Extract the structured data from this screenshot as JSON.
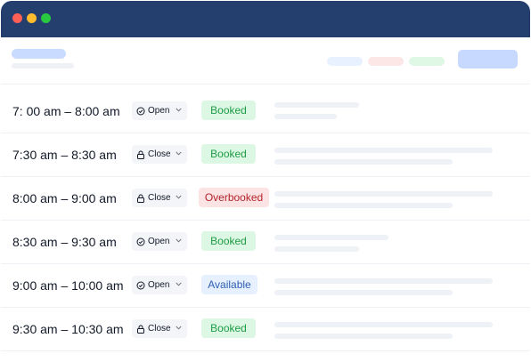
{
  "window": {
    "controls": [
      "close",
      "minimize",
      "maximize"
    ]
  },
  "colors": {
    "titlebar": "#243f6e",
    "booked": "#1f9d46",
    "overbooked": "#b4232b",
    "available": "#2f5fb3"
  },
  "slots": [
    {
      "time": "7: 00 am – 8:00 am",
      "state": "Open",
      "state_icon": "clock-icon",
      "status": "Booked",
      "status_kind": "booked"
    },
    {
      "time": "7:30 am – 8:30 am",
      "state": "Close",
      "state_icon": "lock-icon",
      "status": "Booked",
      "status_kind": "booked"
    },
    {
      "time": "8:00 am – 9:00 am",
      "state": "Close",
      "state_icon": "lock-icon",
      "status": "Overbooked",
      "status_kind": "overbooked"
    },
    {
      "time": "8:30 am – 9:30 am",
      "state": "Open",
      "state_icon": "clock-icon",
      "status": "Booked",
      "status_kind": "booked"
    },
    {
      "time": "9:00 am – 10:00 am",
      "state": "Open",
      "state_icon": "clock-icon",
      "status": "Available",
      "status_kind": "available"
    },
    {
      "time": "9:30 am – 10:30 am",
      "state": "Close",
      "state_icon": "lock-icon",
      "status": "Booked",
      "status_kind": "booked"
    }
  ]
}
